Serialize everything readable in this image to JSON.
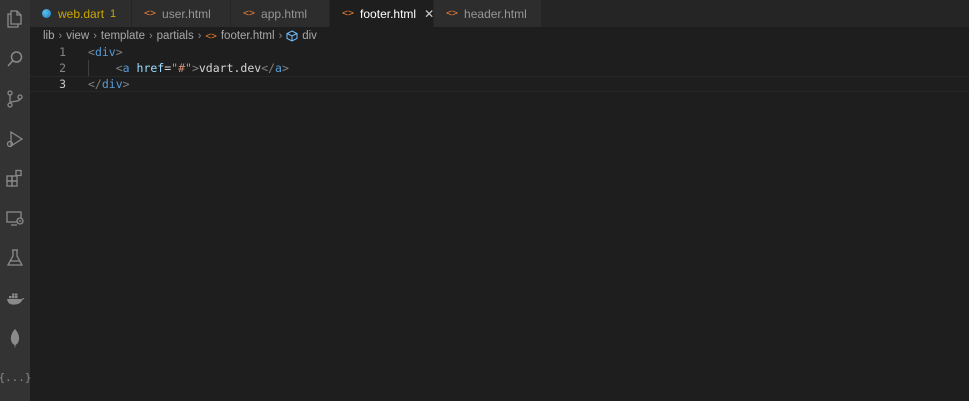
{
  "tabs": [
    {
      "label": "web.dart",
      "badge": "1",
      "icon": "dart-icon"
    },
    {
      "label": "user.html",
      "icon": "html-icon"
    },
    {
      "label": "app.html",
      "icon": "html-icon"
    },
    {
      "label": "footer.html",
      "icon": "html-icon",
      "active": true,
      "close": "✕"
    },
    {
      "label": "header.html",
      "icon": "html-icon"
    }
  ],
  "html_glyph": "<>",
  "breadcrumb": {
    "items": [
      "lib",
      "view",
      "template",
      "partials",
      "footer.html",
      "div"
    ],
    "separator": "›"
  },
  "editor": {
    "line_numbers": [
      "1",
      "2",
      "3"
    ],
    "current_line": 3,
    "lines": [
      {
        "tokens": [
          "<",
          "div",
          ">"
        ]
      },
      {
        "indent": "    ",
        "tokens": [
          "<",
          "a",
          "href",
          "=",
          "\"#\"",
          ">",
          "vdart.dev",
          "</",
          "a",
          ">"
        ]
      },
      {
        "tokens": [
          "</",
          "div",
          ">"
        ]
      }
    ]
  },
  "activity_bar": {
    "icons": [
      "explorer-icon",
      "search-icon",
      "source-control-icon",
      "run-debug-icon",
      "extensions-icon",
      "remote-explorer-icon",
      "testing-icon",
      "docker-icon",
      "mongodb-icon",
      "json-icon"
    ],
    "json_label": "{...}"
  },
  "colors": {
    "editor_bg": "#1e1e1e",
    "activity_bar_bg": "#333333",
    "tab_inactive_bg": "#2d2d2d",
    "html_icon": "#e37933",
    "warning": "#cca700",
    "tag": "#569cd6",
    "attribute": "#9cdcfe",
    "string": "#ce9178"
  }
}
